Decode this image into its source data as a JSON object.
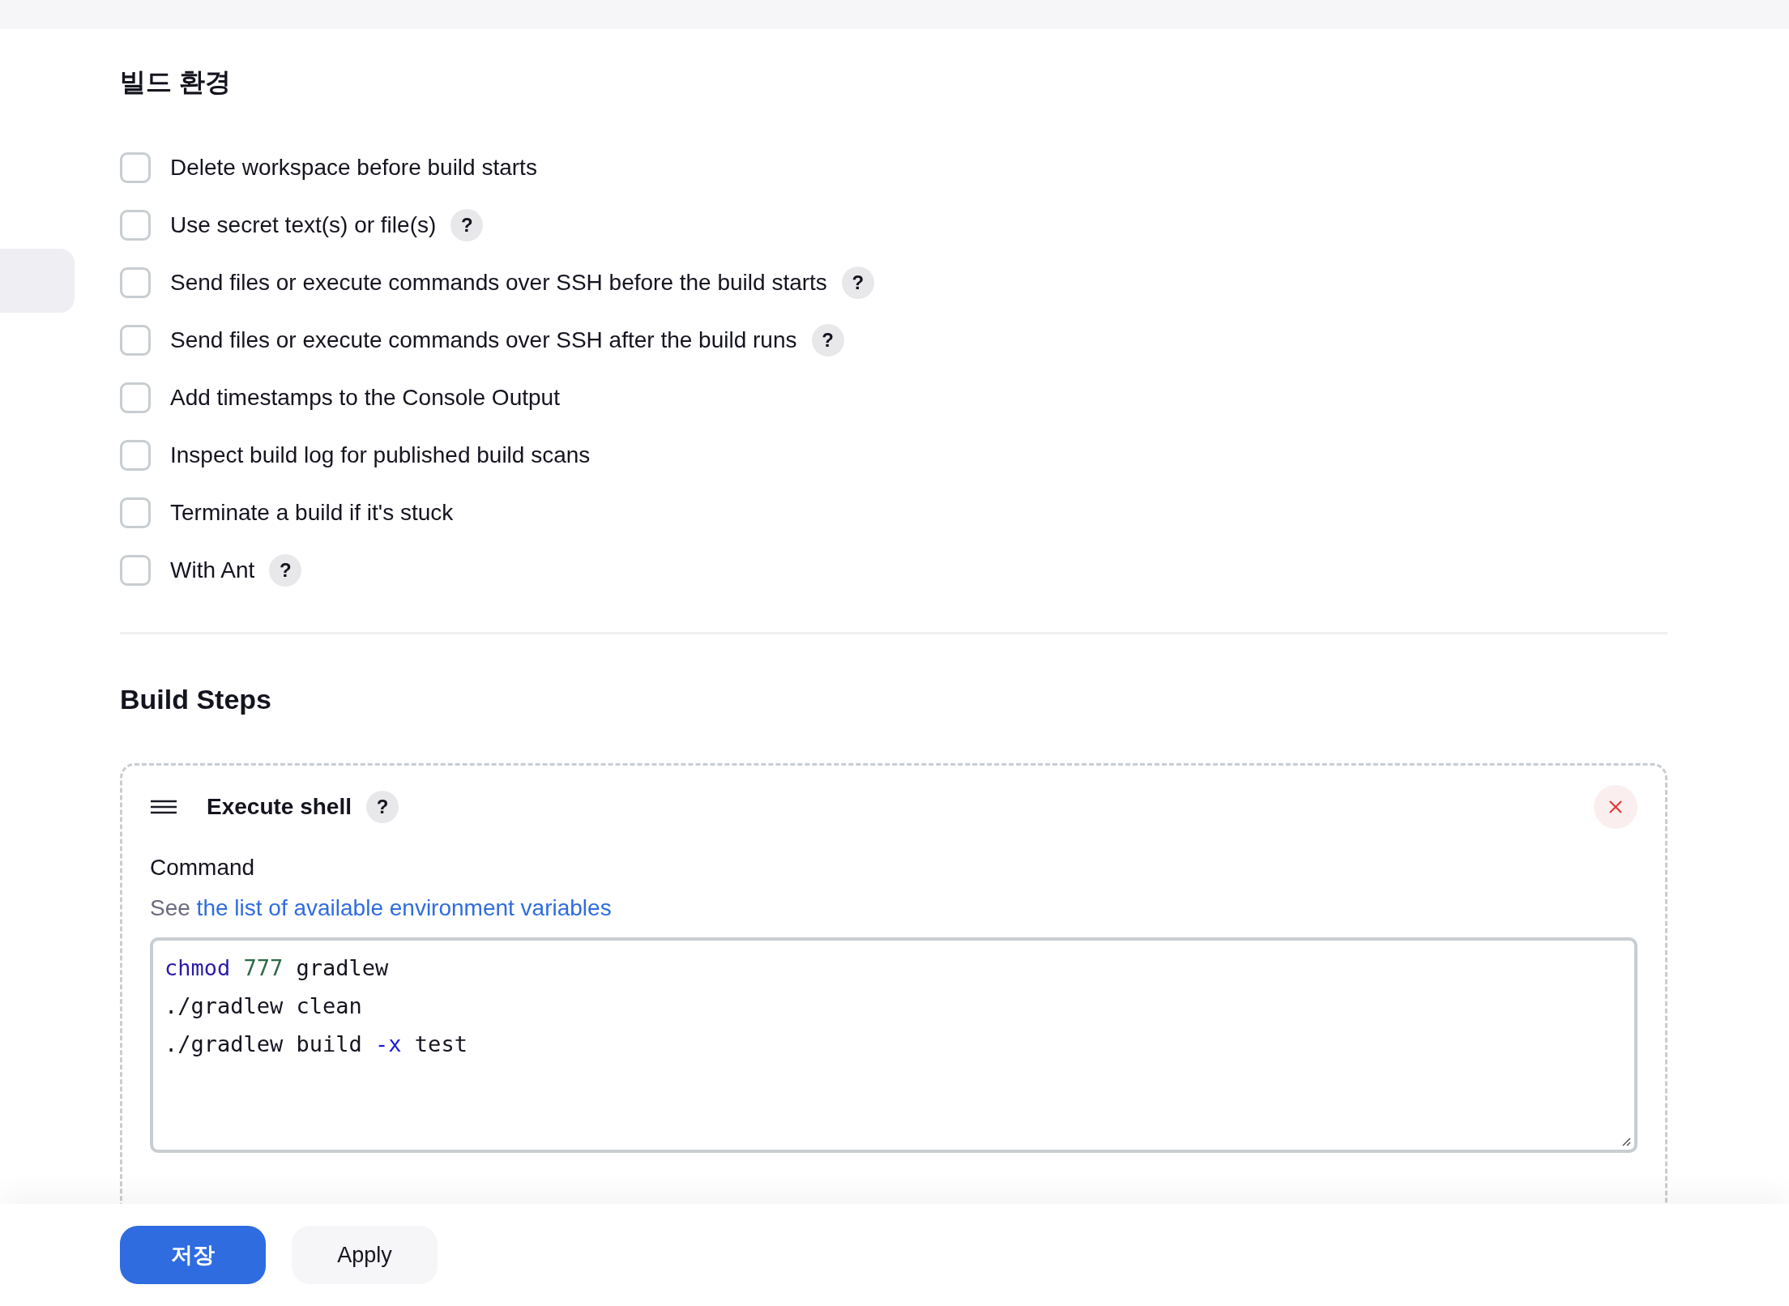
{
  "build_environment": {
    "title": "빌드 환경",
    "options": [
      {
        "label": "Delete workspace before build starts",
        "checked": false
      },
      {
        "label": "Use secret text(s) or file(s)",
        "checked": false,
        "help": "?"
      },
      {
        "label": "Send files or execute commands over SSH before the build starts",
        "checked": false,
        "help": "?"
      },
      {
        "label": "Send files or execute commands over SSH after the build runs",
        "checked": false,
        "help": "?"
      },
      {
        "label": "Add timestamps to the Console Output",
        "checked": false
      },
      {
        "label": "Inspect build log for published build scans",
        "checked": false
      },
      {
        "label": "Terminate a build if it's stuck",
        "checked": false
      },
      {
        "label": "With Ant",
        "checked": false,
        "help": "?"
      }
    ]
  },
  "build_steps": {
    "title": "Build Steps",
    "step": {
      "title": "Execute shell",
      "help": "?",
      "field_label": "Command",
      "hint_prefix": "See",
      "hint_link": "the list of available environment variables",
      "lines": [
        [
          {
            "text": "chmod",
            "kind": "keyword"
          },
          {
            "text": " 777",
            "kind": "number"
          },
          {
            "text": " gradlew",
            "kind": "plain"
          }
        ],
        [
          {
            "text": "./gradlew clean",
            "kind": "plain"
          }
        ],
        [
          {
            "text": "./gradlew build ",
            "kind": "plain"
          },
          {
            "text": "-x",
            "kind": "flag"
          },
          {
            "text": " test",
            "kind": "plain"
          }
        ]
      ]
    }
  },
  "buttons": [
    {
      "label": "저장",
      "kind": "primary"
    },
    {
      "label": "Apply",
      "kind": "secondary"
    }
  ]
}
